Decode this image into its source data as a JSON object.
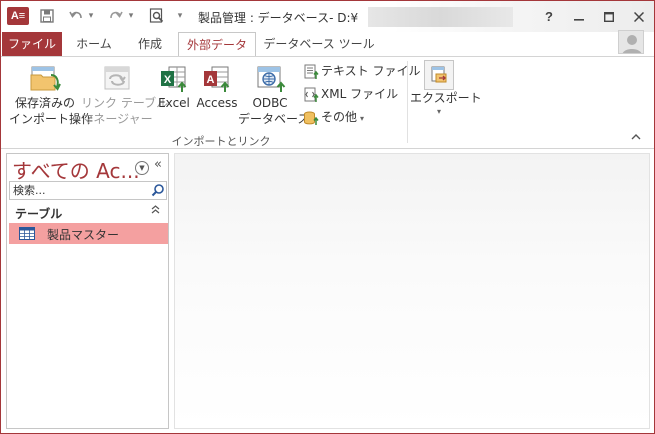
{
  "app": {
    "logo": "A≡",
    "title": "製品管理 : データベース- D:¥"
  },
  "qat": {
    "save_icon": "save-icon",
    "undo_icon": "undo-icon",
    "redo_icon": "redo-icon",
    "preview_icon": "print-preview-icon"
  },
  "window_controls": {
    "help": "?"
  },
  "tabs": {
    "file": "ファイル",
    "home": "ホーム",
    "create": "作成",
    "external": "外部データ",
    "dbtools": "データベース ツール"
  },
  "ribbon": {
    "saved_imports": [
      "保存済みの",
      "インポート操作"
    ],
    "linked_mgr": [
      "リンク テーブル",
      "マネージャー"
    ],
    "excel": "Excel",
    "access": "Access",
    "odbc": [
      "ODBC",
      "データベース"
    ],
    "text_file": "テキスト ファイル",
    "xml_file": "XML ファイル",
    "more": "その他",
    "group_import": "インポートとリンク",
    "export": "エクスポート"
  },
  "nav": {
    "title": "すべての Ac...",
    "search_placeholder": "検索...",
    "group": "テーブル",
    "items": [
      {
        "label": "製品マスター"
      }
    ]
  },
  "colors": {
    "accent": "#a4373a",
    "selected": "#f4a0a0"
  }
}
